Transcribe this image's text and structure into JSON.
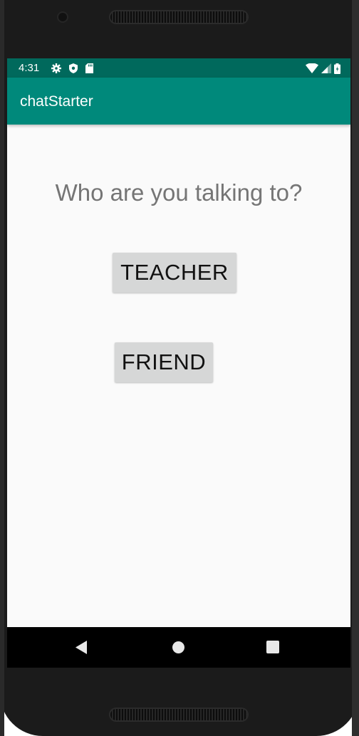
{
  "status_bar": {
    "time": "4:31",
    "left_icons": [
      "settings-gear-icon",
      "shield-icon",
      "sd-card-icon"
    ],
    "right_icons": [
      "wifi-icon",
      "cell-signal-icon",
      "battery-icon"
    ],
    "color": "#00695c"
  },
  "app_bar": {
    "title": "chatStarter",
    "color": "#00897b"
  },
  "main": {
    "prompt": "Who are you talking to?",
    "teacher_button": "TEACHER",
    "friend_button": "FRIEND"
  },
  "nav_bar": {
    "icons": [
      "back-icon",
      "home-icon",
      "recents-icon"
    ]
  }
}
